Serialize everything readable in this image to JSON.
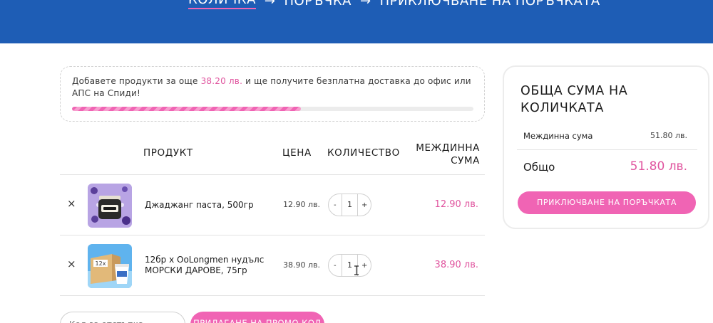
{
  "header": {
    "steps": [
      "КОЛИЧКА",
      "ПОРЪЧКА",
      "ПРИКЛЮЧВАНЕ НА ПОРЪЧКАТА"
    ],
    "arrow": "→",
    "background_color": "#1e5db5"
  },
  "shipping_notice": {
    "text_before": "Добавете продукти за още ",
    "amount": "38.20 лв.",
    "text_after": " и ще получите безплатна доставка до офис или АПС на Спиди!",
    "progress_fraction": 0.57
  },
  "table": {
    "headers": {
      "product": "ПРОДУКТ",
      "price": "ЦЕНА",
      "quantity": "КОЛИЧЕСТВО",
      "subtotal_line1": "МЕЖДИННА",
      "subtotal_line2": "СУМА"
    },
    "rows": [
      {
        "remove": "×",
        "name": "Джаджанг паста, 500гр",
        "price": "12.90 лв.",
        "qty": "1",
        "minus": "-",
        "plus": "+",
        "subtotal": "12.90 лв.",
        "thumb_badge": ""
      },
      {
        "remove": "×",
        "name": "12бр х OoLongmen нудълс МОРСКИ ДАРОВЕ, 75гр",
        "price": "38.90 лв.",
        "qty": "1",
        "minus": "-",
        "plus": "+",
        "subtotal": "38.90 лв.",
        "thumb_badge": "12x"
      }
    ]
  },
  "coupon": {
    "placeholder": "Код за отстъпка",
    "button_label": "ПРИЛАГАНЕ НА ПРОМО КОД"
  },
  "totals": {
    "title": "ОБЩА СУМА НА КОЛИЧКАТА",
    "subtotal_label": "Междинна сума",
    "subtotal_value": "51.80 лв.",
    "total_label": "Общо",
    "total_value": "51.80 лв.",
    "checkout_label": "ПРИКЛЮЧВАНЕ НА ПОРЪЧКАТА"
  },
  "colors": {
    "accent": "#f064b4",
    "price_pink": "#e0559f",
    "brand_blue": "#1e5db5"
  }
}
